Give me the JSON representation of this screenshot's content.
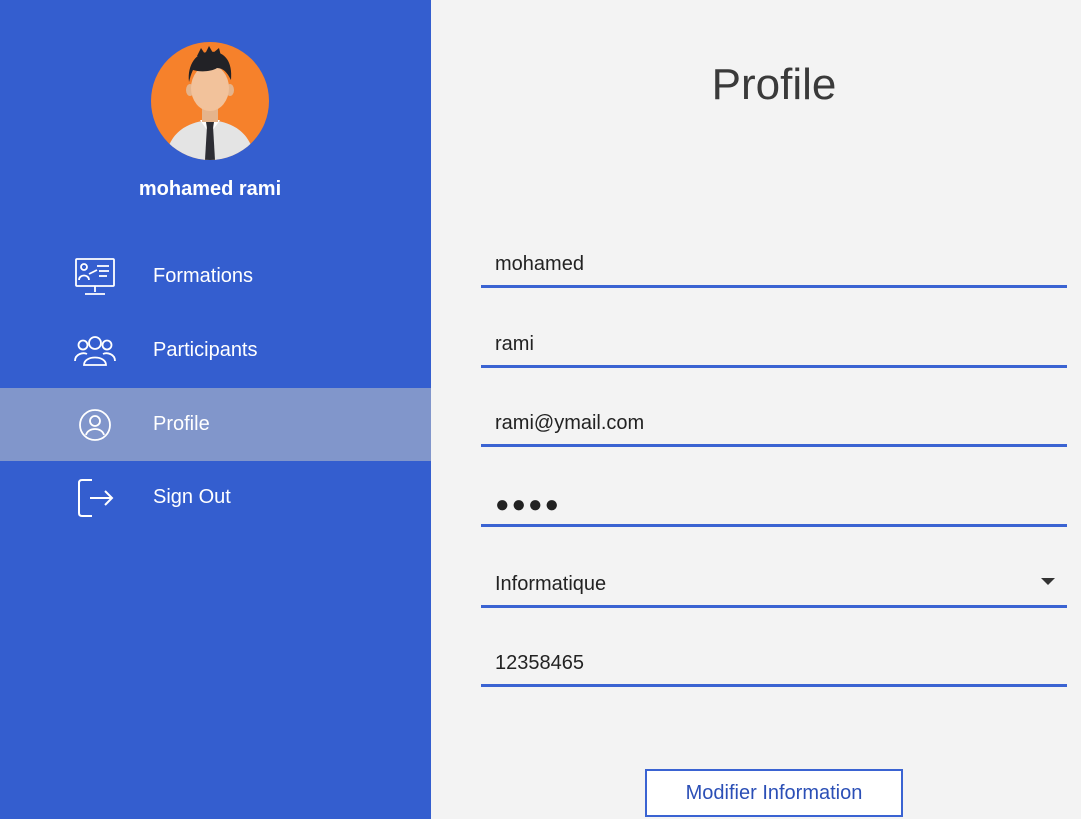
{
  "sidebar": {
    "user_name": "mohamed rami",
    "avatar": {
      "icon": "user-avatar-icon",
      "background": "#f6812b"
    },
    "background": "#345ecf",
    "active_background": "#8196cb",
    "items": [
      {
        "label": "Formations",
        "icon": "presentation-monitor-icon",
        "active": false
      },
      {
        "label": "Participants",
        "icon": "people-group-icon",
        "active": false
      },
      {
        "label": "Profile",
        "icon": "user-circle-icon",
        "active": true
      },
      {
        "label": "Sign Out",
        "icon": "sign-out-icon",
        "active": false
      }
    ]
  },
  "main": {
    "title": "Profile",
    "form": {
      "first_name": "mohamed",
      "last_name": "rami",
      "email": "rami@ymail.com",
      "password_masked": "●●●●",
      "department": "Informatique",
      "phone": "12358465"
    },
    "submit_label": "Modifier Information",
    "accent": "#3a63d2"
  }
}
